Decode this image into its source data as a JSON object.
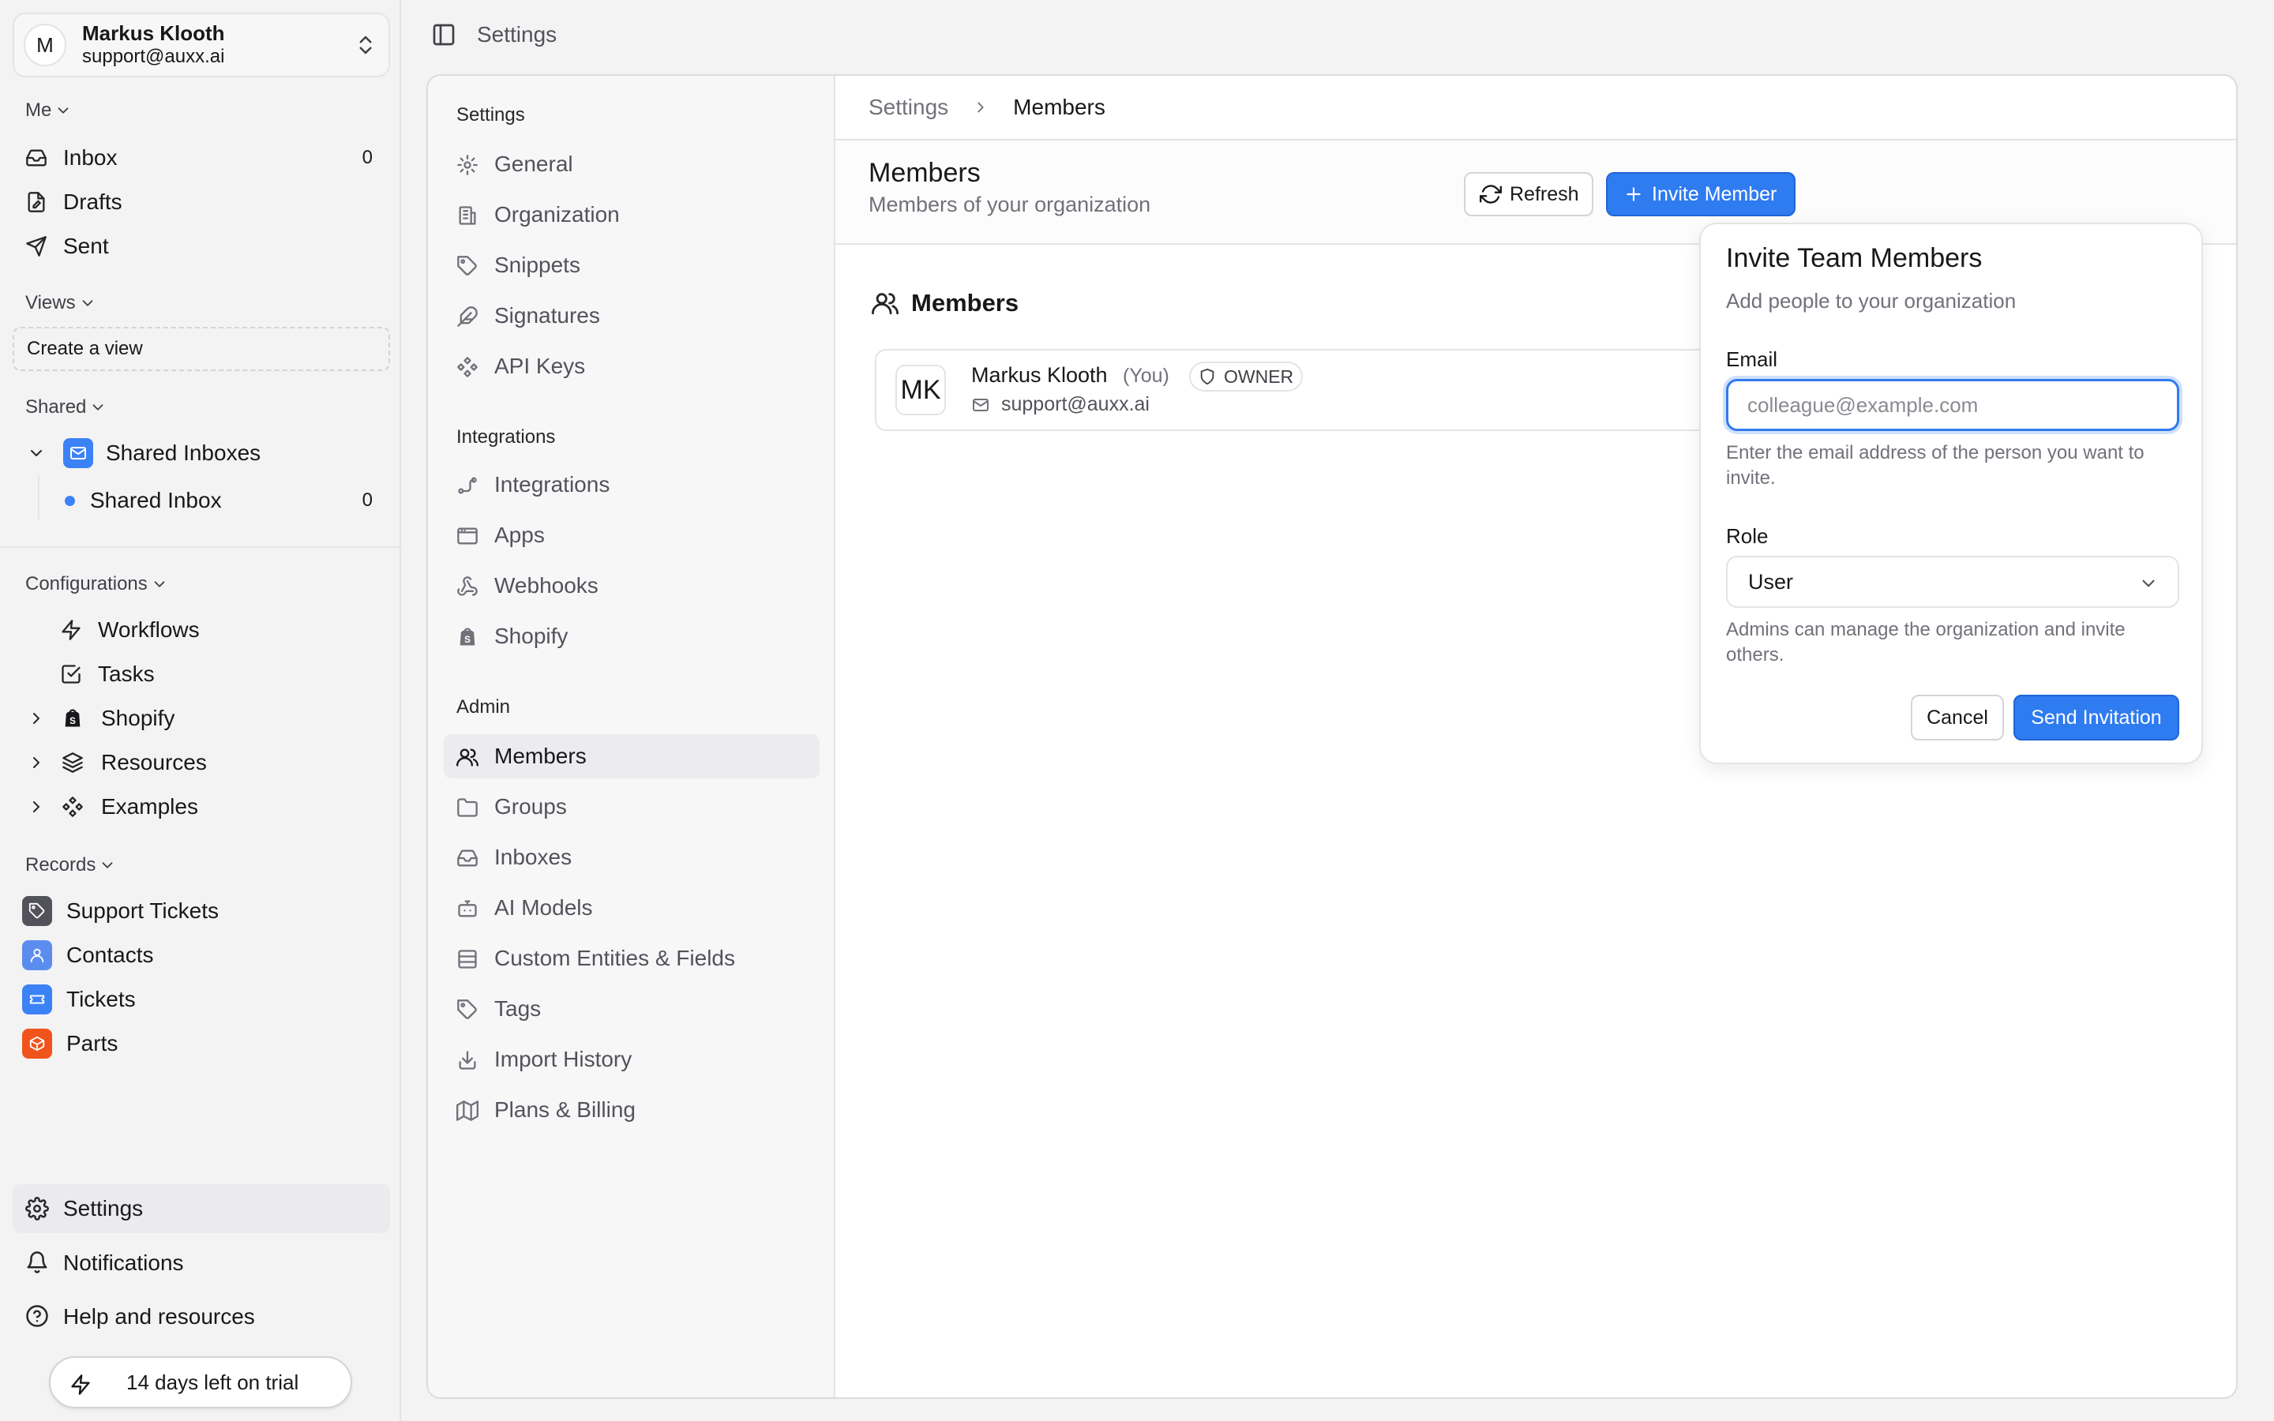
{
  "user": {
    "initial": "M",
    "name": "Markus Klooth",
    "email": "support@auxx.ai"
  },
  "sidebar": {
    "me_label": "Me",
    "me_items": [
      {
        "label": "Inbox",
        "count": "0",
        "icon": "inbox-icon"
      },
      {
        "label": "Drafts",
        "icon": "drafts-icon"
      },
      {
        "label": "Sent",
        "icon": "send-icon"
      }
    ],
    "views_label": "Views",
    "create_view": "Create a view",
    "shared_label": "Shared",
    "shared_group": "Shared Inboxes",
    "shared_inbox": {
      "label": "Shared Inbox",
      "count": "0"
    },
    "config_label": "Configurations",
    "config_items": [
      {
        "label": "Workflows",
        "icon": "lightning-icon"
      },
      {
        "label": "Tasks",
        "icon": "task-check-icon"
      },
      {
        "label": "Shopify",
        "icon": "shopify-icon"
      },
      {
        "label": "Resources",
        "icon": "layers-icon"
      },
      {
        "label": "Examples",
        "icon": "components-icon"
      }
    ],
    "records_label": "Records",
    "records": [
      {
        "label": "Support Tickets",
        "color": "#52525b"
      },
      {
        "label": "Contacts",
        "color": "#5b8def"
      },
      {
        "label": "Tickets",
        "color": "#3b82f6"
      },
      {
        "label": "Parts",
        "color": "#f0531c"
      }
    ],
    "bottom": [
      {
        "label": "Settings",
        "icon": "gear-icon"
      },
      {
        "label": "Notifications",
        "icon": "bell-icon"
      },
      {
        "label": "Help and resources",
        "icon": "help-icon"
      }
    ],
    "trial": "14 days left on trial"
  },
  "header": {
    "title": "Settings"
  },
  "settings_nav": {
    "section_settings": "Settings",
    "settings_items": [
      "General",
      "Organization",
      "Snippets",
      "Signatures",
      "API Keys"
    ],
    "section_integrations": "Integrations",
    "integrations_items": [
      "Integrations",
      "Apps",
      "Webhooks",
      "Shopify"
    ],
    "section_admin": "Admin",
    "admin_items": [
      "Members",
      "Groups",
      "Inboxes",
      "AI Models",
      "Custom Entities & Fields",
      "Tags",
      "Import History",
      "Plans & Billing"
    ]
  },
  "breadcrumb": {
    "root": "Settings",
    "current": "Members"
  },
  "page": {
    "title": "Members",
    "subtitle": "Members of your organization",
    "refresh_label": "Refresh",
    "invite_label": "Invite Member",
    "section_title": "Members"
  },
  "member": {
    "initials": "MK",
    "name": "Markus Klooth",
    "you_tag": "(You)",
    "role_badge": "OWNER",
    "email": "support@auxx.ai"
  },
  "invite_dialog": {
    "title": "Invite Team Members",
    "subtitle": "Add people to your organization",
    "email_label": "Email",
    "email_placeholder": "colleague@example.com",
    "email_help": "Enter the email address of the person you want to invite.",
    "role_label": "Role",
    "role_value": "User",
    "role_help": "Admins can manage the organization and invite others.",
    "cancel_label": "Cancel",
    "send_label": "Send Invitation"
  },
  "colors": {
    "accent": "#2f7bf0",
    "active_nav": "#ececee"
  }
}
